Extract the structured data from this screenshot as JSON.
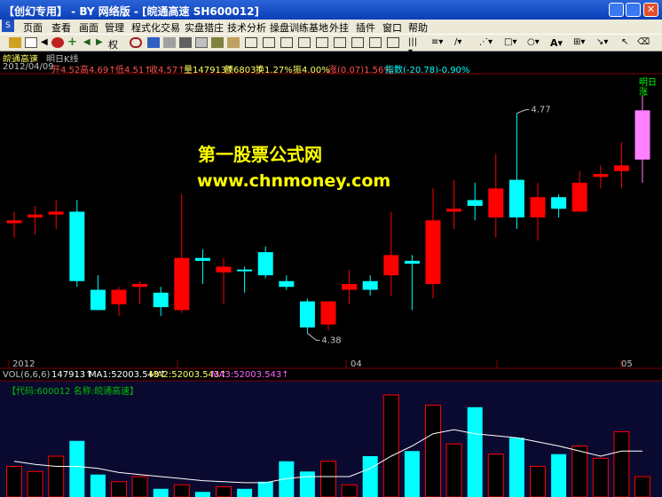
{
  "window": {
    "title": "【创幻专用】 - BY 网络版 - [皖通高速  SH600012]"
  },
  "menu": [
    "页面",
    "查看",
    "画面",
    "管理",
    "程式化交易",
    "实盘猎庄",
    "技术分析",
    "操盘训练基地",
    "外挂",
    "插件",
    "窗口",
    "帮助"
  ],
  "toolbar": {
    "right_label": "权",
    "icons": [
      "logo-icon",
      "page-icon",
      "arrow-left-icon",
      "record-icon",
      "plus-icon",
      "back-icon",
      "forward-icon",
      "rights-icon",
      "glasses-icon",
      "pen-icon",
      "square-icon",
      "chip-icon",
      "grid-icon",
      "brush-icon",
      "box-icon",
      "grid2-icon",
      "grid3-icon",
      "grid4-icon",
      "bar-icon",
      "line-icon",
      "wave-icon",
      "select-icon",
      "rect-icon",
      "circle-icon",
      "text-icon",
      "aa-icon",
      "arrow-icon"
    ]
  },
  "stock": {
    "name": "皖通高速",
    "period": "明日K线"
  },
  "info": {
    "date": "2012/04/09",
    "open": "开4.52",
    "high": "高4.69↑",
    "low": "低4.51↑",
    "close": "收4.57↑",
    "volume": "量147913↑",
    "amount": "额6803↑",
    "turnover": "换1.27%",
    "amplitude": "振4.00%",
    "change": "涨(0.07)1.56%",
    "index": "指数(-20.78)-0.90%"
  },
  "watermark": {
    "line1": "第一股票公式网",
    "line2": "www.chnmoney.com"
  },
  "tomorrow_label": [
    "明日",
    "涨"
  ],
  "axis_labels": [
    {
      "text": "2012",
      "pos": "left"
    },
    {
      "text": "04",
      "pos": "mid"
    },
    {
      "text": "05",
      "pos": "right"
    }
  ],
  "volume_panel": {
    "header": "VOL(6,6,6)",
    "vol_value": "147913↑",
    "ma1": "MA1:52003.543↑",
    "ma2": "MA2:52003.543↑",
    "ma3": "MA3:52003.543↑",
    "code_label": "【代码:600012 名称:皖通高速】"
  },
  "colors": {
    "up": "#ff0000",
    "down": "#00ffff",
    "ma": "#ffffff",
    "tomorrow": "#ff80ff",
    "volume_bg": "#000000"
  },
  "chart_data": {
    "type": "candlestick",
    "annotations": [
      {
        "text": "4.77",
        "kind": "high"
      },
      {
        "text": "4.38",
        "kind": "low"
      }
    ],
    "candles": [
      {
        "o": 4.585,
        "h": 4.6,
        "l": 4.555,
        "c": 4.58,
        "up": true
      },
      {
        "o": 4.59,
        "h": 4.61,
        "l": 4.56,
        "c": 4.595,
        "up": true
      },
      {
        "o": 4.595,
        "h": 4.62,
        "l": 4.57,
        "c": 4.6,
        "up": true
      },
      {
        "o": 4.6,
        "h": 4.62,
        "l": 4.47,
        "c": 4.48,
        "up": false
      },
      {
        "o": 4.465,
        "h": 4.49,
        "l": 4.43,
        "c": 4.43,
        "up": false
      },
      {
        "o": 4.44,
        "h": 4.47,
        "l": 4.42,
        "c": 4.465,
        "up": true
      },
      {
        "o": 4.47,
        "h": 4.48,
        "l": 4.44,
        "c": 4.475,
        "up": true
      },
      {
        "o": 4.46,
        "h": 4.47,
        "l": 4.42,
        "c": 4.435,
        "up": false
      },
      {
        "o": 4.43,
        "h": 4.63,
        "l": 4.425,
        "c": 4.52,
        "up": true
      },
      {
        "o": 4.52,
        "h": 4.535,
        "l": 4.475,
        "c": 4.515,
        "up": false
      },
      {
        "o": 4.495,
        "h": 4.52,
        "l": 4.44,
        "c": 4.505,
        "up": true
      },
      {
        "o": 4.5,
        "h": 4.505,
        "l": 4.46,
        "c": 4.5,
        "up": false
      },
      {
        "o": 4.53,
        "h": 4.54,
        "l": 4.485,
        "c": 4.49,
        "up": false
      },
      {
        "o": 4.48,
        "h": 4.49,
        "l": 4.465,
        "c": 4.47,
        "up": false
      },
      {
        "o": 4.445,
        "h": 4.45,
        "l": 4.39,
        "c": 4.4,
        "up": false
      },
      {
        "o": 4.405,
        "h": 4.44,
        "l": 4.395,
        "c": 4.445,
        "up": true
      },
      {
        "o": 4.465,
        "h": 4.5,
        "l": 4.44,
        "c": 4.475,
        "up": true
      },
      {
        "o": 4.48,
        "h": 4.49,
        "l": 4.455,
        "c": 4.465,
        "up": false
      },
      {
        "o": 4.49,
        "h": 4.6,
        "l": 4.455,
        "c": 4.525,
        "up": true
      },
      {
        "o": 4.515,
        "h": 4.525,
        "l": 4.43,
        "c": 4.51,
        "up": false
      },
      {
        "o": 4.475,
        "h": 4.64,
        "l": 4.45,
        "c": 4.585,
        "up": true
      },
      {
        "o": 4.6,
        "h": 4.655,
        "l": 4.57,
        "c": 4.605,
        "up": true
      },
      {
        "o": 4.61,
        "h": 4.65,
        "l": 4.585,
        "c": 4.62,
        "up": false
      },
      {
        "o": 4.59,
        "h": 4.7,
        "l": 4.555,
        "c": 4.64,
        "up": true
      },
      {
        "o": 4.655,
        "h": 4.77,
        "l": 4.57,
        "c": 4.59,
        "up": false
      },
      {
        "o": 4.59,
        "h": 4.65,
        "l": 4.55,
        "c": 4.625,
        "up": true
      },
      {
        "o": 4.625,
        "h": 4.63,
        "l": 4.59,
        "c": 4.605,
        "up": false
      },
      {
        "o": 4.6,
        "h": 4.67,
        "l": 4.6,
        "c": 4.65,
        "up": true
      },
      {
        "o": 4.66,
        "h": 4.68,
        "l": 4.64,
        "c": 4.665,
        "up": true
      },
      {
        "o": 4.67,
        "h": 4.72,
        "l": 4.64,
        "c": 4.68,
        "up": true
      },
      {
        "o": 4.69,
        "h": 4.8,
        "l": 4.65,
        "c": 4.775,
        "up": true,
        "tomorrow": true
      }
    ],
    "volumes": [
      0.3,
      0.25,
      0.4,
      0.55,
      0.22,
      0.15,
      0.2,
      0.08,
      0.12,
      0.05,
      0.1,
      0.08,
      0.15,
      0.35,
      0.25,
      0.35,
      0.12,
      0.4,
      1.0,
      0.45,
      0.9,
      0.52,
      0.88,
      0.42,
      0.58,
      0.3,
      0.42,
      0.5,
      0.38,
      0.64,
      0.2
    ],
    "vol_ma": [
      0.35,
      0.32,
      0.3,
      0.3,
      0.28,
      0.24,
      0.22,
      0.2,
      0.18,
      0.16,
      0.15,
      0.14,
      0.14,
      0.18,
      0.2,
      0.2,
      0.2,
      0.28,
      0.4,
      0.5,
      0.62,
      0.66,
      0.62,
      0.6,
      0.58,
      0.54,
      0.5,
      0.45,
      0.4,
      0.45,
      0.45
    ]
  }
}
